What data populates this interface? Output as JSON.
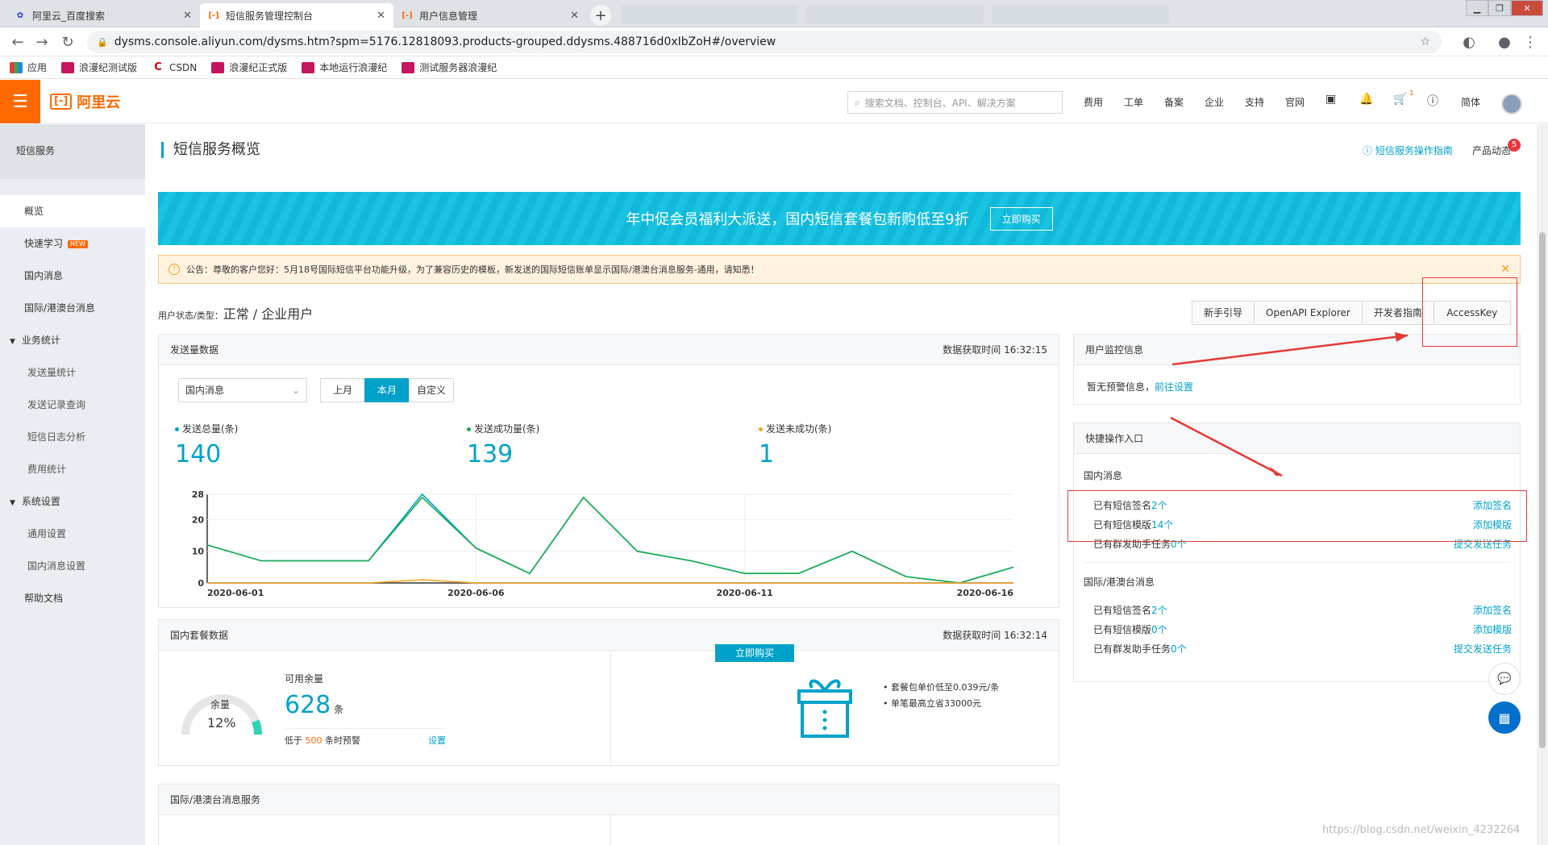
{
  "browser": {
    "tabs": [
      {
        "title": "阿里云_百度搜索",
        "icon": "baidu-icon"
      },
      {
        "title": "短信服务管理控制台",
        "icon": "aliyun-icon"
      },
      {
        "title": "用户信息管理",
        "icon": "aliyun-icon"
      }
    ],
    "url": "dysms.console.aliyun.com/dysms.htm?spm=5176.12818093.products-grouped.ddysms.488716d0xIbZoH#/overview",
    "bookmarks": [
      "应用",
      "浪漫纪测试版",
      "CSDN",
      "浪漫纪正式版",
      "本地运行浪漫纪",
      "测试服务器浪漫纪"
    ]
  },
  "topbar": {
    "logo": "阿里云",
    "search_placeholder": "搜索文档、控制台、API、解决方案",
    "nav": [
      "费用",
      "工单",
      "备案",
      "企业",
      "支持",
      "官网"
    ],
    "cart_badge": "1",
    "lang": "简体"
  },
  "sidebar": {
    "title": "短信服务",
    "items": [
      "概览",
      "快速学习",
      "国内消息",
      "国际/港澳台消息",
      "业务统计",
      "发送量统计",
      "发送记录查询",
      "短信日志分析",
      "费用统计",
      "系统设置",
      "通用设置",
      "国内消息设置",
      "帮助文档"
    ],
    "new_badge": "NEW"
  },
  "page": {
    "title": "短信服务概览",
    "guide_link": "短信服务操作指南",
    "product_news": "产品动态",
    "product_news_badge": "5",
    "banner_text": "年中促会员福利大派送，国内短信套餐包新购低至9折",
    "banner_button": "立即购买",
    "notice": "公告：尊敬的客户您好：5月18号国际短信平台功能升级，为了兼容历史的模板，新发送的国际短信账单显示国际/港澳台消息服务-通用，请知悉！",
    "user_state_label": "用户状态/类型：",
    "user_state_value": "正常 / 企业用户",
    "buttons": [
      "新手引导",
      "OpenAPI Explorer",
      "开发者指南",
      "AccessKey"
    ]
  },
  "send_panel": {
    "title": "发送量数据",
    "time": "数据获取时间 16:32:15",
    "select": "国内消息",
    "segments": [
      "上月",
      "本月",
      "自定义"
    ],
    "kpis": [
      {
        "label": "发送总量(条)",
        "value": "140",
        "color": "#00a2ca"
      },
      {
        "label": "发送成功量(条)",
        "value": "139",
        "color": "#1aab4c"
      },
      {
        "label": "发送未成功(条)",
        "value": "1",
        "color": "#f5a623"
      }
    ]
  },
  "chart_data": {
    "type": "line",
    "x": [
      "2020-06-01",
      "2020-06-02",
      "2020-06-03",
      "2020-06-04",
      "2020-06-05",
      "2020-06-06",
      "2020-06-07",
      "2020-06-08",
      "2020-06-09",
      "2020-06-10",
      "2020-06-11",
      "2020-06-12",
      "2020-06-13",
      "2020-06-14",
      "2020-06-15",
      "2020-06-16"
    ],
    "xticks": [
      "2020-06-01",
      "2020-06-06",
      "2020-06-11",
      "2020-06-16"
    ],
    "yticks": [
      0,
      10,
      20,
      28
    ],
    "ylim": [
      0,
      28
    ],
    "series": [
      {
        "color": "#00a2ca",
        "values": [
          12,
          7,
          7,
          7,
          28,
          11,
          3,
          27,
          10,
          7,
          3,
          3,
          10,
          2,
          0,
          5
        ]
      },
      {
        "color": "#1aab4c",
        "values": [
          12,
          7,
          7,
          7,
          27,
          11,
          3,
          27,
          10,
          7,
          3,
          3,
          10,
          2,
          0,
          5
        ]
      },
      {
        "color": "#f5a623",
        "values": [
          0,
          0,
          0,
          0,
          1,
          0,
          0,
          0,
          0,
          0,
          0,
          0,
          0,
          0,
          0,
          0
        ]
      }
    ]
  },
  "package_panel": {
    "title": "国内套餐数据",
    "time": "数据获取时间 16:32:14",
    "gauge_label": "余量",
    "gauge_percent": "12%",
    "gauge_fraction": 0.12,
    "avail_label": "可用余量",
    "avail_value": "628",
    "avail_unit": "条",
    "warn_pre": "低于",
    "warn_num": "500",
    "warn_post": "条时预警",
    "warn_link": "设置",
    "buy_button": "立即购买",
    "bullets": [
      "套餐包单价低至0.039元/条",
      "单笔最高立省33000元"
    ]
  },
  "intl_panel": {
    "title": "国际/港澳台消息服务"
  },
  "monitor_panel": {
    "title": "用户监控信息",
    "text": "暂无预警信息，",
    "link": "前往设置"
  },
  "quick_panel": {
    "title": "快捷操作入口",
    "domestic_title": "国内消息",
    "domestic": [
      {
        "label": "已有短信签名",
        "count": "2个",
        "link": "添加签名"
      },
      {
        "label": "已有短信模版",
        "count": "14个",
        "link": "添加模版"
      },
      {
        "label": "已有群发助手任务",
        "count": "0个",
        "link": "提交发送任务"
      }
    ],
    "intl_title": "国际/港澳台消息",
    "intl": [
      {
        "label": "已有短信签名",
        "count": "2个",
        "link": "添加签名"
      },
      {
        "label": "已有短信模版",
        "count": "0个",
        "link": "添加模版"
      },
      {
        "label": "已有群发助手任务",
        "count": "0个",
        "link": "提交发送任务"
      }
    ]
  },
  "watermark": "https://blog.csdn.net/weixin_4232264"
}
